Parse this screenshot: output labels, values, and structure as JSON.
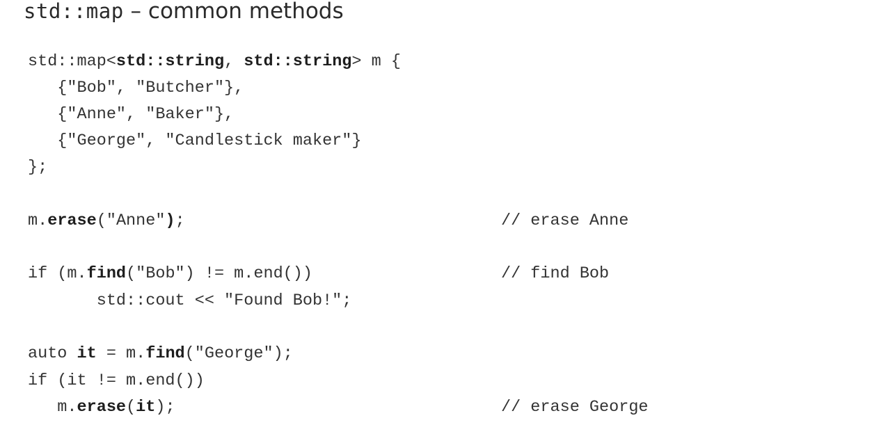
{
  "slide": {
    "title_code": "std::map",
    "title_text": " – common methods",
    "code": {
      "decl": {
        "pre": "std::map<",
        "type1": "std::string",
        "sep": ", ",
        "type2": "std::string",
        "post": "> m {"
      },
      "entry_bob": "   {\"Bob\", \"Butcher\"},",
      "entry_anne": "   {\"Anne\", \"Baker\"},",
      "entry_george": "   {\"George\", \"Candlestick maker\"}",
      "close": "};",
      "erase_anne": {
        "pre": "m.",
        "method": "erase",
        "args": "(\"Anne\"",
        "paren": ")",
        "post": ";"
      },
      "find_bob": {
        "pre": "if (m.",
        "method": "find",
        "post": "(\"Bob\") != m.end())"
      },
      "cout_bob": "       std::cout << \"Found Bob!\";",
      "auto_it": {
        "pre": "auto ",
        "var": "it",
        "mid": " = m.",
        "method": "find",
        "post": "(\"George\");"
      },
      "if_it": "if (it != m.end())",
      "erase_it": {
        "pre": "   m.",
        "method": "erase",
        "open": "(",
        "var": "it",
        "post": ");"
      }
    },
    "comments": {
      "erase_anne": "// erase Anne",
      "find_bob": "// find Bob",
      "erase_george": "// erase George"
    }
  }
}
